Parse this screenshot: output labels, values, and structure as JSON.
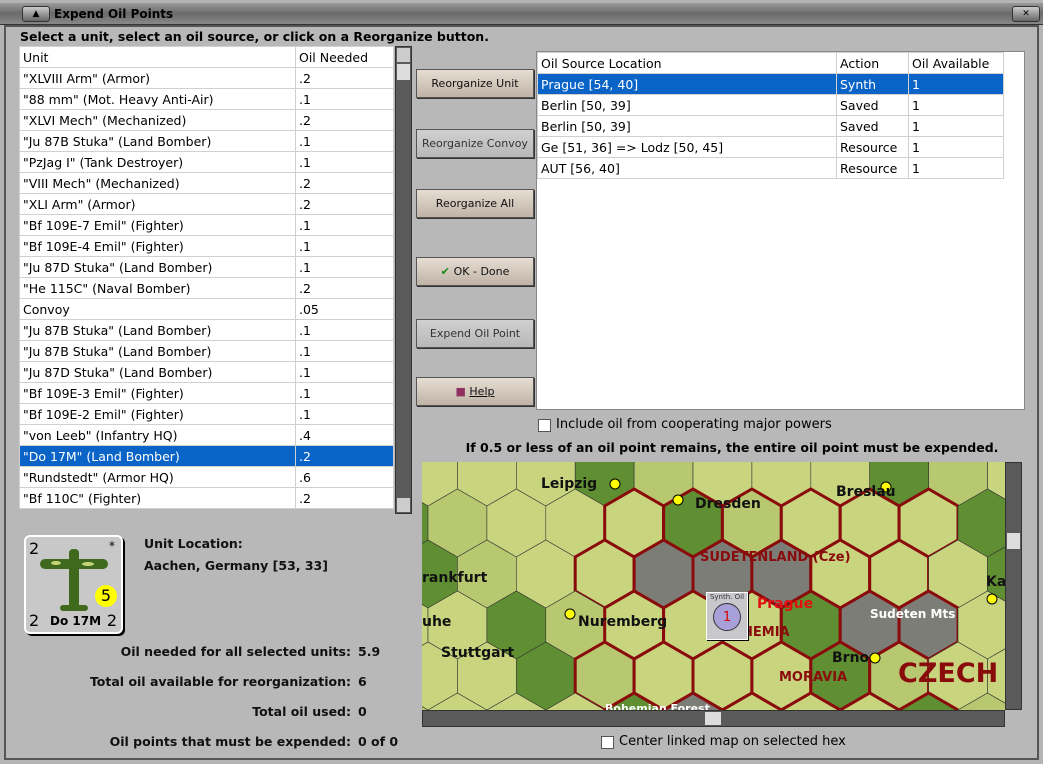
{
  "window": {
    "title": "Expend Oil Points"
  },
  "instruction": "Select a unit, select an oil source, or click on a Reorganize button.",
  "units": {
    "headers": [
      "Unit",
      "Oil Needed"
    ],
    "rows": [
      [
        "\"XLVIII Arm\" (Armor)",
        ".2"
      ],
      [
        "\"88 mm\" (Mot. Heavy Anti-Air)",
        ".1"
      ],
      [
        "\"XLVI Mech\" (Mechanized)",
        ".2"
      ],
      [
        "\"Ju 87B Stuka\" (Land Bomber)",
        ".1"
      ],
      [
        "\"PzJag I\" (Tank Destroyer)",
        ".1"
      ],
      [
        "\"VIII Mech\" (Mechanized)",
        ".2"
      ],
      [
        "\"XLI Arm\" (Armor)",
        ".2"
      ],
      [
        "\"Bf 109E-7 Emil\" (Fighter)",
        ".1"
      ],
      [
        "\"Bf 109E-4 Emil\" (Fighter)",
        ".1"
      ],
      [
        "\"Ju 87D Stuka\" (Land Bomber)",
        ".1"
      ],
      [
        "\"He 115C\" (Naval Bomber)",
        ".2"
      ],
      [
        "Convoy",
        ".05"
      ],
      [
        "\"Ju 87B Stuka\" (Land Bomber)",
        ".1"
      ],
      [
        "\"Ju 87B Stuka\" (Land Bomber)",
        ".1"
      ],
      [
        "\"Ju 87D Stuka\" (Land Bomber)",
        ".1"
      ],
      [
        "\"Bf 109E-3 Emil\" (Fighter)",
        ".1"
      ],
      [
        "\"Bf 109E-2 Emil\" (Fighter)",
        ".1"
      ],
      [
        "\"von Leeb\" (Infantry HQ)",
        ".4"
      ],
      [
        "\"Do 17M\" (Land Bomber)",
        ".2"
      ],
      [
        "\"Rundstedt\" (Armor HQ)",
        ".6"
      ],
      [
        "\"Bf 110C\" (Fighter)",
        ".2"
      ]
    ],
    "selected_index": 18
  },
  "buttons": {
    "reorganize_unit": "Reorganize Unit",
    "reorganize_convoy": "Reorganize Convoy",
    "reorganize_all": "Reorganize All",
    "ok_done": "OK - Done",
    "expend_oil_point": "Expend Oil Point",
    "help": "Help"
  },
  "sources": {
    "headers": [
      "Oil Source Location",
      "Action",
      "Oil Available"
    ],
    "rows": [
      [
        "Prague [54, 40]",
        "Synth",
        "1"
      ],
      [
        "Berlin [50, 39]",
        "Saved",
        "1"
      ],
      [
        "Berlin [50, 39]",
        "Saved",
        "1"
      ],
      [
        "Ge [51, 36] => Lodz [50, 45]",
        "Resource",
        "1"
      ],
      [
        "AUT [56, 40]",
        "Resource",
        "1"
      ]
    ],
    "selected_index": 0
  },
  "include_cooperating": {
    "label": "Include oil from cooperating major powers",
    "checked": false
  },
  "notice": "If 0.5 or less of an oil point remains, the entire oil point must be expended.",
  "unit_card": {
    "attack": "2",
    "defense_left": "2",
    "defense_right": "2",
    "name": "Do 17M",
    "badge": "5",
    "star": "*"
  },
  "unit_location": {
    "label": "Unit Location:",
    "value": "Aachen, Germany [53, 33]"
  },
  "stats": [
    {
      "label": "Oil needed for all selected units:",
      "value": "5.9"
    },
    {
      "label": "Total oil available for reorganization:",
      "value": "6"
    },
    {
      "label": "Total oil used:",
      "value": "0"
    },
    {
      "label": "Oil points that must be expended:",
      "value": "0 of 0"
    }
  ],
  "map": {
    "labels": [
      "Leipzig",
      "Dresden",
      "Breslau",
      "SUDETENLAND (Cze)",
      "rankfurt",
      "Nuremberg",
      "Prague",
      "Sudeten Mts",
      "uhe",
      "Stuttgart",
      "Brno",
      "MORAVIA",
      "CZECH",
      "HEMIA",
      "Bohemian Forest",
      "Ka"
    ],
    "counter_label": "Synth. Oil",
    "counter_value": "1"
  },
  "center_linked": {
    "label": "Center linked map on selected hex",
    "checked": false
  }
}
